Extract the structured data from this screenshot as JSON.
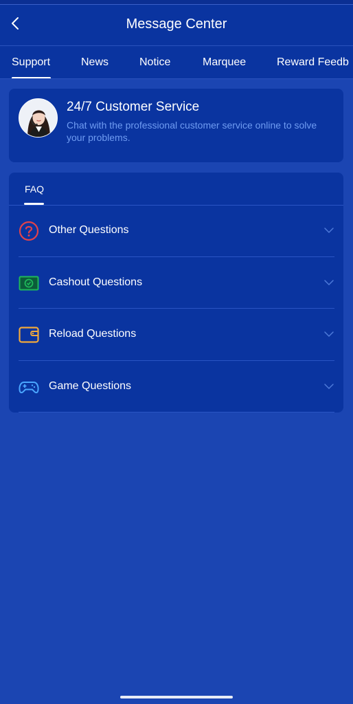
{
  "header": {
    "title": "Message Center",
    "back_icon": "chevron-left-icon"
  },
  "tabs": [
    {
      "label": "Support",
      "active": true
    },
    {
      "label": "News",
      "active": false
    },
    {
      "label": "Notice",
      "active": false
    },
    {
      "label": "Marquee",
      "active": false
    },
    {
      "label": "Reward Feedb",
      "active": false
    }
  ],
  "service": {
    "title": "24/7 Customer Service",
    "description": "Chat with the professional customer service online to solve your problems.",
    "avatar_icon": "customer-service-agent-avatar"
  },
  "faq": {
    "tab_label": "FAQ",
    "items": [
      {
        "label": "Other Questions",
        "icon": "question-circle-icon",
        "color": "#e0424b"
      },
      {
        "label": "Cashout Questions",
        "icon": "cash-icon",
        "color": "#1fb85a"
      },
      {
        "label": "Reload Questions",
        "icon": "wallet-icon",
        "color": "#f2a93b"
      },
      {
        "label": "Game Questions",
        "icon": "gamepad-icon",
        "color": "#4aa6ff"
      }
    ]
  },
  "colors": {
    "background": "#1b45b2",
    "card": "#0a34a0",
    "accent_text": "#6f9cf2"
  }
}
